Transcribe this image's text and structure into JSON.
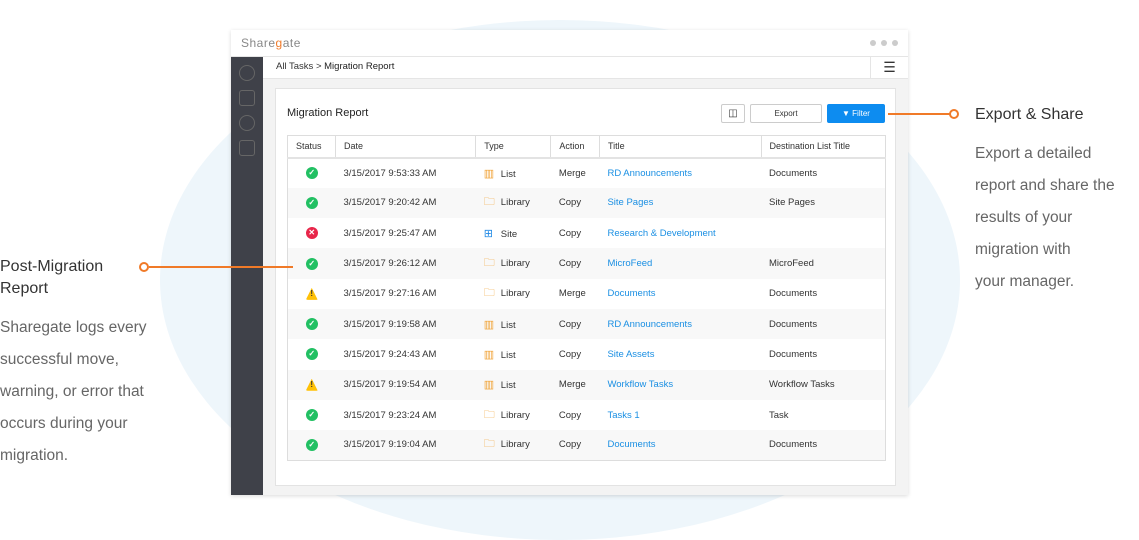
{
  "app": {
    "title_pre": "Share",
    "title_g": "g",
    "title_post": "ate"
  },
  "breadcrumb": {
    "parent": "All Tasks",
    "sep": " > ",
    "current": "Migration Report"
  },
  "card": {
    "title": "Migration Report",
    "export": "Export",
    "filter": "Filter",
    "columns_icon": "columns-add-icon"
  },
  "table": {
    "headers": [
      "Status",
      "Date",
      "Type",
      "Action",
      "Title",
      "Destination List Title"
    ],
    "rows": [
      {
        "status": "success",
        "date": "3/15/2017 9:53:33 AM",
        "type": "List",
        "action": "Merge",
        "title": "RD Announcements",
        "dest": "Documents"
      },
      {
        "status": "success",
        "date": "3/15/2017 9:20:42 AM",
        "type": "Library",
        "action": "Copy",
        "title": "Site Pages",
        "dest": "Site Pages"
      },
      {
        "status": "error",
        "date": "3/15/2017 9:25:47 AM",
        "type": "Site",
        "action": "Copy",
        "title": "Research & Development",
        "dest": ""
      },
      {
        "status": "success",
        "date": "3/15/2017 9:26:12 AM",
        "type": "Library",
        "action": "Copy",
        "title": "MicroFeed",
        "dest": "MicroFeed"
      },
      {
        "status": "warning",
        "date": "3/15/2017 9:27:16 AM",
        "type": "Library",
        "action": "Merge",
        "title": "Documents",
        "dest": "Documents"
      },
      {
        "status": "success",
        "date": "3/15/2017 9:19:58 AM",
        "type": "List",
        "action": "Copy",
        "title": "RD Announcements",
        "dest": "Documents"
      },
      {
        "status": "success",
        "date": "3/15/2017 9:24:43 AM",
        "type": "List",
        "action": "Copy",
        "title": "Site Assets",
        "dest": "Documents"
      },
      {
        "status": "warning",
        "date": "3/15/2017 9:19:54 AM",
        "type": "List",
        "action": "Merge",
        "title": "Workflow Tasks",
        "dest": "Workflow Tasks"
      },
      {
        "status": "success",
        "date": "3/15/2017 9:23:24 AM",
        "type": "Library",
        "action": "Copy",
        "title": "Tasks 1",
        "dest": "Task"
      },
      {
        "status": "success",
        "date": "3/15/2017 9:19:04 AM",
        "type": "Library",
        "action": "Copy",
        "title": "Documents",
        "dest": "Documents"
      }
    ]
  },
  "left_note": {
    "title": "Post-Migration Report",
    "lines": [
      "Sharegate logs every",
      "successful move,",
      "warning, or error that",
      "occurs during your",
      "migration."
    ]
  },
  "right_note": {
    "title": "Export & Share",
    "lines": [
      "Export a detailed",
      "report and share the",
      "results of your",
      "migration with",
      "your manager."
    ]
  },
  "colors": {
    "accent": "#f07a28",
    "primary": "#0d8cf0",
    "success": "#22c063",
    "error": "#e8264a",
    "warning": "#ffc107"
  }
}
